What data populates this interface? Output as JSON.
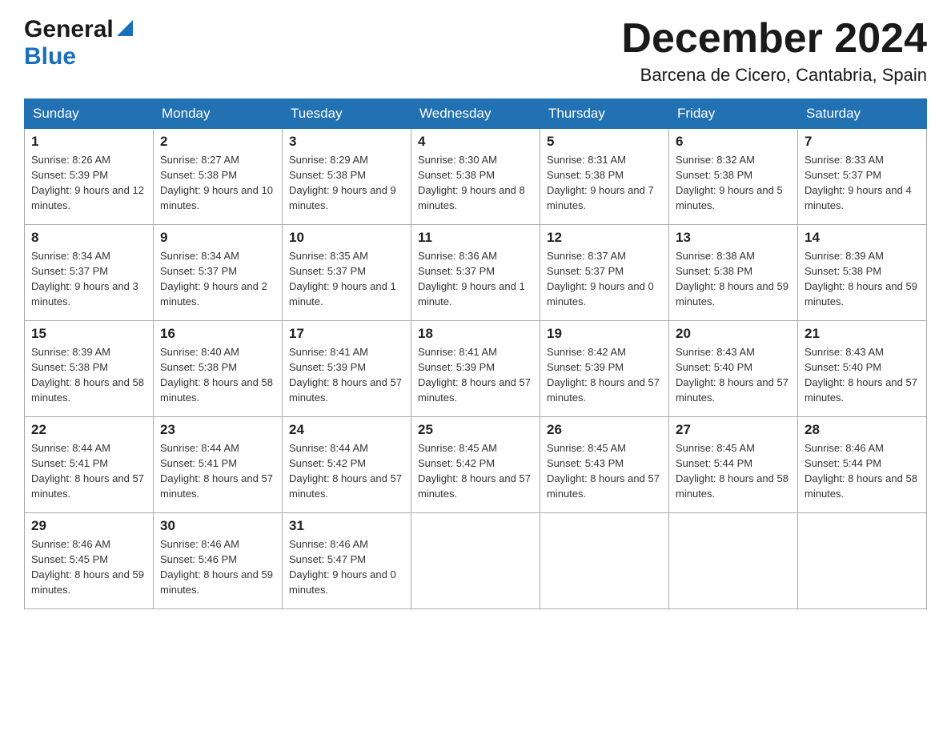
{
  "header": {
    "logo_general": "General",
    "logo_blue": "Blue",
    "month_title": "December 2024",
    "location": "Barcena de Cicero, Cantabria, Spain"
  },
  "weekdays": [
    "Sunday",
    "Monday",
    "Tuesday",
    "Wednesday",
    "Thursday",
    "Friday",
    "Saturday"
  ],
  "weeks": [
    [
      {
        "day": "1",
        "sunrise": "8:26 AM",
        "sunset": "5:39 PM",
        "daylight": "9 hours and 12 minutes."
      },
      {
        "day": "2",
        "sunrise": "8:27 AM",
        "sunset": "5:38 PM",
        "daylight": "9 hours and 10 minutes."
      },
      {
        "day": "3",
        "sunrise": "8:29 AM",
        "sunset": "5:38 PM",
        "daylight": "9 hours and 9 minutes."
      },
      {
        "day": "4",
        "sunrise": "8:30 AM",
        "sunset": "5:38 PM",
        "daylight": "9 hours and 8 minutes."
      },
      {
        "day": "5",
        "sunrise": "8:31 AM",
        "sunset": "5:38 PM",
        "daylight": "9 hours and 7 minutes."
      },
      {
        "day": "6",
        "sunrise": "8:32 AM",
        "sunset": "5:38 PM",
        "daylight": "9 hours and 5 minutes."
      },
      {
        "day": "7",
        "sunrise": "8:33 AM",
        "sunset": "5:37 PM",
        "daylight": "9 hours and 4 minutes."
      }
    ],
    [
      {
        "day": "8",
        "sunrise": "8:34 AM",
        "sunset": "5:37 PM",
        "daylight": "9 hours and 3 minutes."
      },
      {
        "day": "9",
        "sunrise": "8:34 AM",
        "sunset": "5:37 PM",
        "daylight": "9 hours and 2 minutes."
      },
      {
        "day": "10",
        "sunrise": "8:35 AM",
        "sunset": "5:37 PM",
        "daylight": "9 hours and 1 minute."
      },
      {
        "day": "11",
        "sunrise": "8:36 AM",
        "sunset": "5:37 PM",
        "daylight": "9 hours and 1 minute."
      },
      {
        "day": "12",
        "sunrise": "8:37 AM",
        "sunset": "5:37 PM",
        "daylight": "9 hours and 0 minutes."
      },
      {
        "day": "13",
        "sunrise": "8:38 AM",
        "sunset": "5:38 PM",
        "daylight": "8 hours and 59 minutes."
      },
      {
        "day": "14",
        "sunrise": "8:39 AM",
        "sunset": "5:38 PM",
        "daylight": "8 hours and 59 minutes."
      }
    ],
    [
      {
        "day": "15",
        "sunrise": "8:39 AM",
        "sunset": "5:38 PM",
        "daylight": "8 hours and 58 minutes."
      },
      {
        "day": "16",
        "sunrise": "8:40 AM",
        "sunset": "5:38 PM",
        "daylight": "8 hours and 58 minutes."
      },
      {
        "day": "17",
        "sunrise": "8:41 AM",
        "sunset": "5:39 PM",
        "daylight": "8 hours and 57 minutes."
      },
      {
        "day": "18",
        "sunrise": "8:41 AM",
        "sunset": "5:39 PM",
        "daylight": "8 hours and 57 minutes."
      },
      {
        "day": "19",
        "sunrise": "8:42 AM",
        "sunset": "5:39 PM",
        "daylight": "8 hours and 57 minutes."
      },
      {
        "day": "20",
        "sunrise": "8:43 AM",
        "sunset": "5:40 PM",
        "daylight": "8 hours and 57 minutes."
      },
      {
        "day": "21",
        "sunrise": "8:43 AM",
        "sunset": "5:40 PM",
        "daylight": "8 hours and 57 minutes."
      }
    ],
    [
      {
        "day": "22",
        "sunrise": "8:44 AM",
        "sunset": "5:41 PM",
        "daylight": "8 hours and 57 minutes."
      },
      {
        "day": "23",
        "sunrise": "8:44 AM",
        "sunset": "5:41 PM",
        "daylight": "8 hours and 57 minutes."
      },
      {
        "day": "24",
        "sunrise": "8:44 AM",
        "sunset": "5:42 PM",
        "daylight": "8 hours and 57 minutes."
      },
      {
        "day": "25",
        "sunrise": "8:45 AM",
        "sunset": "5:42 PM",
        "daylight": "8 hours and 57 minutes."
      },
      {
        "day": "26",
        "sunrise": "8:45 AM",
        "sunset": "5:43 PM",
        "daylight": "8 hours and 57 minutes."
      },
      {
        "day": "27",
        "sunrise": "8:45 AM",
        "sunset": "5:44 PM",
        "daylight": "8 hours and 58 minutes."
      },
      {
        "day": "28",
        "sunrise": "8:46 AM",
        "sunset": "5:44 PM",
        "daylight": "8 hours and 58 minutes."
      }
    ],
    [
      {
        "day": "29",
        "sunrise": "8:46 AM",
        "sunset": "5:45 PM",
        "daylight": "8 hours and 59 minutes."
      },
      {
        "day": "30",
        "sunrise": "8:46 AM",
        "sunset": "5:46 PM",
        "daylight": "8 hours and 59 minutes."
      },
      {
        "day": "31",
        "sunrise": "8:46 AM",
        "sunset": "5:47 PM",
        "daylight": "9 hours and 0 minutes."
      },
      null,
      null,
      null,
      null
    ]
  ]
}
